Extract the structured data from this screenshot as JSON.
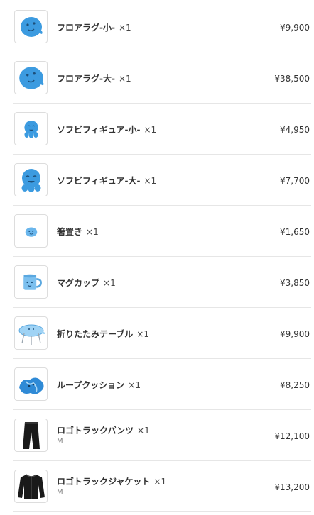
{
  "items": [
    {
      "name": "フロアラグ-小-",
      "qty": "×1",
      "variant": "",
      "price": "¥9,900",
      "icon": "floor-rug-icon"
    },
    {
      "name": "フロアラグ-大-",
      "qty": "×1",
      "variant": "",
      "price": "¥38,500",
      "icon": "floor-rug-icon"
    },
    {
      "name": "ソフビフィギュア-小-",
      "qty": "×1",
      "variant": "",
      "price": "¥4,950",
      "icon": "figure-icon"
    },
    {
      "name": "ソフビフィギュア-大-",
      "qty": "×1",
      "variant": "",
      "price": "¥7,700",
      "icon": "figure-icon"
    },
    {
      "name": "箸置き",
      "qty": "×1",
      "variant": "",
      "price": "¥1,650",
      "icon": "chopstick-rest-icon"
    },
    {
      "name": "マグカップ",
      "qty": "×1",
      "variant": "",
      "price": "¥3,850",
      "icon": "mug-icon"
    },
    {
      "name": "折りたたみテーブル",
      "qty": "×1",
      "variant": "",
      "price": "¥9,900",
      "icon": "folding-table-icon"
    },
    {
      "name": "ループクッション",
      "qty": "×1",
      "variant": "",
      "price": "¥8,250",
      "icon": "cushion-icon"
    },
    {
      "name": "ロゴトラックパンツ",
      "qty": "×1",
      "variant": "M",
      "price": "¥12,100",
      "icon": "track-pants-icon"
    },
    {
      "name": "ロゴトラックジャケット",
      "qty": "×1",
      "variant": "M",
      "price": "¥13,200",
      "icon": "track-jacket-icon"
    }
  ],
  "colors": {
    "character_blue": "#3c9be0",
    "divider": "#e6e6e6"
  }
}
